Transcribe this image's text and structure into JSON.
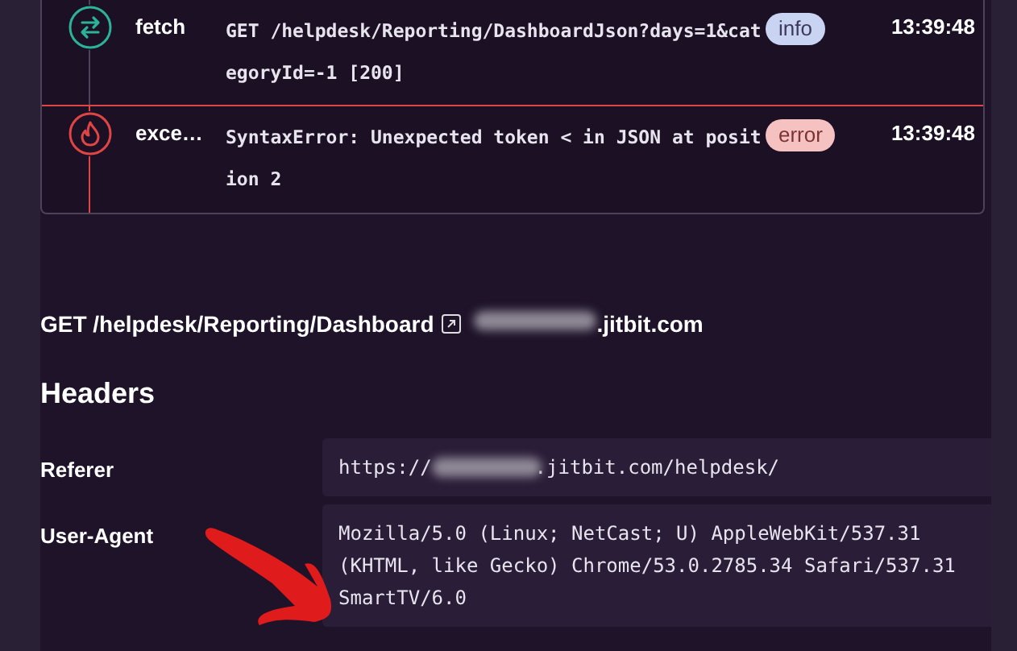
{
  "breadcrumbs": [
    {
      "kind": "fetch",
      "type": "fetch",
      "message": "GET /helpdesk/Reporting/DashboardJson?days=1&categoryId=-1 [200]",
      "level": "info",
      "time": "13:39:48"
    },
    {
      "kind": "exception",
      "type": "exce…",
      "message": "SyntaxError: Unexpected token < in JSON at position 2",
      "level": "error",
      "time": "13:39:48"
    }
  ],
  "request": {
    "method_path": "GET /helpdesk/Reporting/Dashboard",
    "host_suffix": ".jitbit.com"
  },
  "headers": {
    "title": "Headers",
    "rows": [
      {
        "name": "Referer",
        "value_prefix": "https://",
        "value_suffix": ".jitbit.com/helpdesk/"
      },
      {
        "name": "User-Agent",
        "value": "Mozilla/5.0 (Linux; NetCast; U) AppleWebKit/537.31 (KHTML, like Gecko) Chrome/53.0.2785.34 Safari/537.31 SmartTV/6.0"
      }
    ]
  }
}
